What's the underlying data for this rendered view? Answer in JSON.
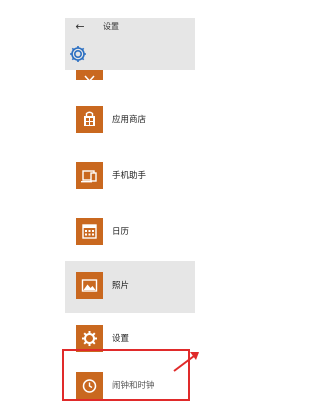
{
  "header": {
    "back_glyph": "←",
    "title": "设置",
    "settings_icon": "gear-icon"
  },
  "items": [
    {
      "label": "",
      "icon": "maps-icon"
    },
    {
      "label": "应用商店",
      "icon": "store-icon"
    },
    {
      "label": "手机助手",
      "icon": "phone-companion-icon"
    },
    {
      "label": "日历",
      "icon": "calendar-icon"
    },
    {
      "label": "照片",
      "icon": "photos-icon"
    },
    {
      "label": "设置",
      "icon": "gear-icon"
    },
    {
      "label": "闹钟和时钟",
      "icon": "alarm-clock-icon"
    }
  ],
  "colors": {
    "tile": "#c9681f",
    "hover_bg": "#e6e6e6",
    "highlight": "#e02a2a"
  }
}
